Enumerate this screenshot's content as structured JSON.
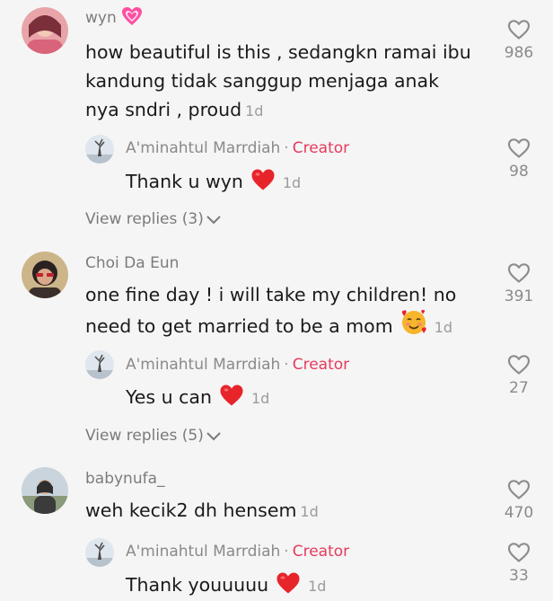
{
  "comments": [
    {
      "username": "wyn",
      "username_emoji": "pink-heart-emoji",
      "text_lines": [
        "how beautiful is this , sedangkn ramai ibu",
        "kandung tidak sanggup menjaga anak",
        "nya sndri , proud"
      ],
      "time": "1d",
      "likes": "986",
      "reply": {
        "username": "A'minahtul Marrdiah",
        "badge": "Creator",
        "text": "Thank u wyn",
        "emoji": "red-heart-emoji",
        "time": "1d",
        "likes": "98"
      },
      "view_replies": "View replies (3)"
    },
    {
      "username": "Choi Da Eun",
      "text_lines": [
        "one fine day ! i will take my children! no",
        "need to get married to be a mom"
      ],
      "emoji": "smiling-face-with-hearts-emoji",
      "time": "1d",
      "likes": "391",
      "reply": {
        "username": "A'minahtul Marrdiah",
        "badge": "Creator",
        "text": "Yes u can",
        "emoji": "red-heart-emoji",
        "time": "1d",
        "likes": "27"
      },
      "view_replies": "View replies (5)"
    },
    {
      "username": "babynufa_",
      "text_lines": [
        "weh kecik2 dh hensem"
      ],
      "time": "1d",
      "likes": "470",
      "reply": {
        "username": "A'minahtul Marrdiah",
        "badge": "Creator",
        "text": "Thank youuuuu",
        "emoji": "red-heart-emoji",
        "time": "1d",
        "likes": "33"
      }
    }
  ],
  "separator": "·",
  "colors": {
    "background": "#f5f5f5",
    "creator_badge": "#e63a5c",
    "heart_red": "#e8242b",
    "meta_gray": "#8a8a8a"
  }
}
